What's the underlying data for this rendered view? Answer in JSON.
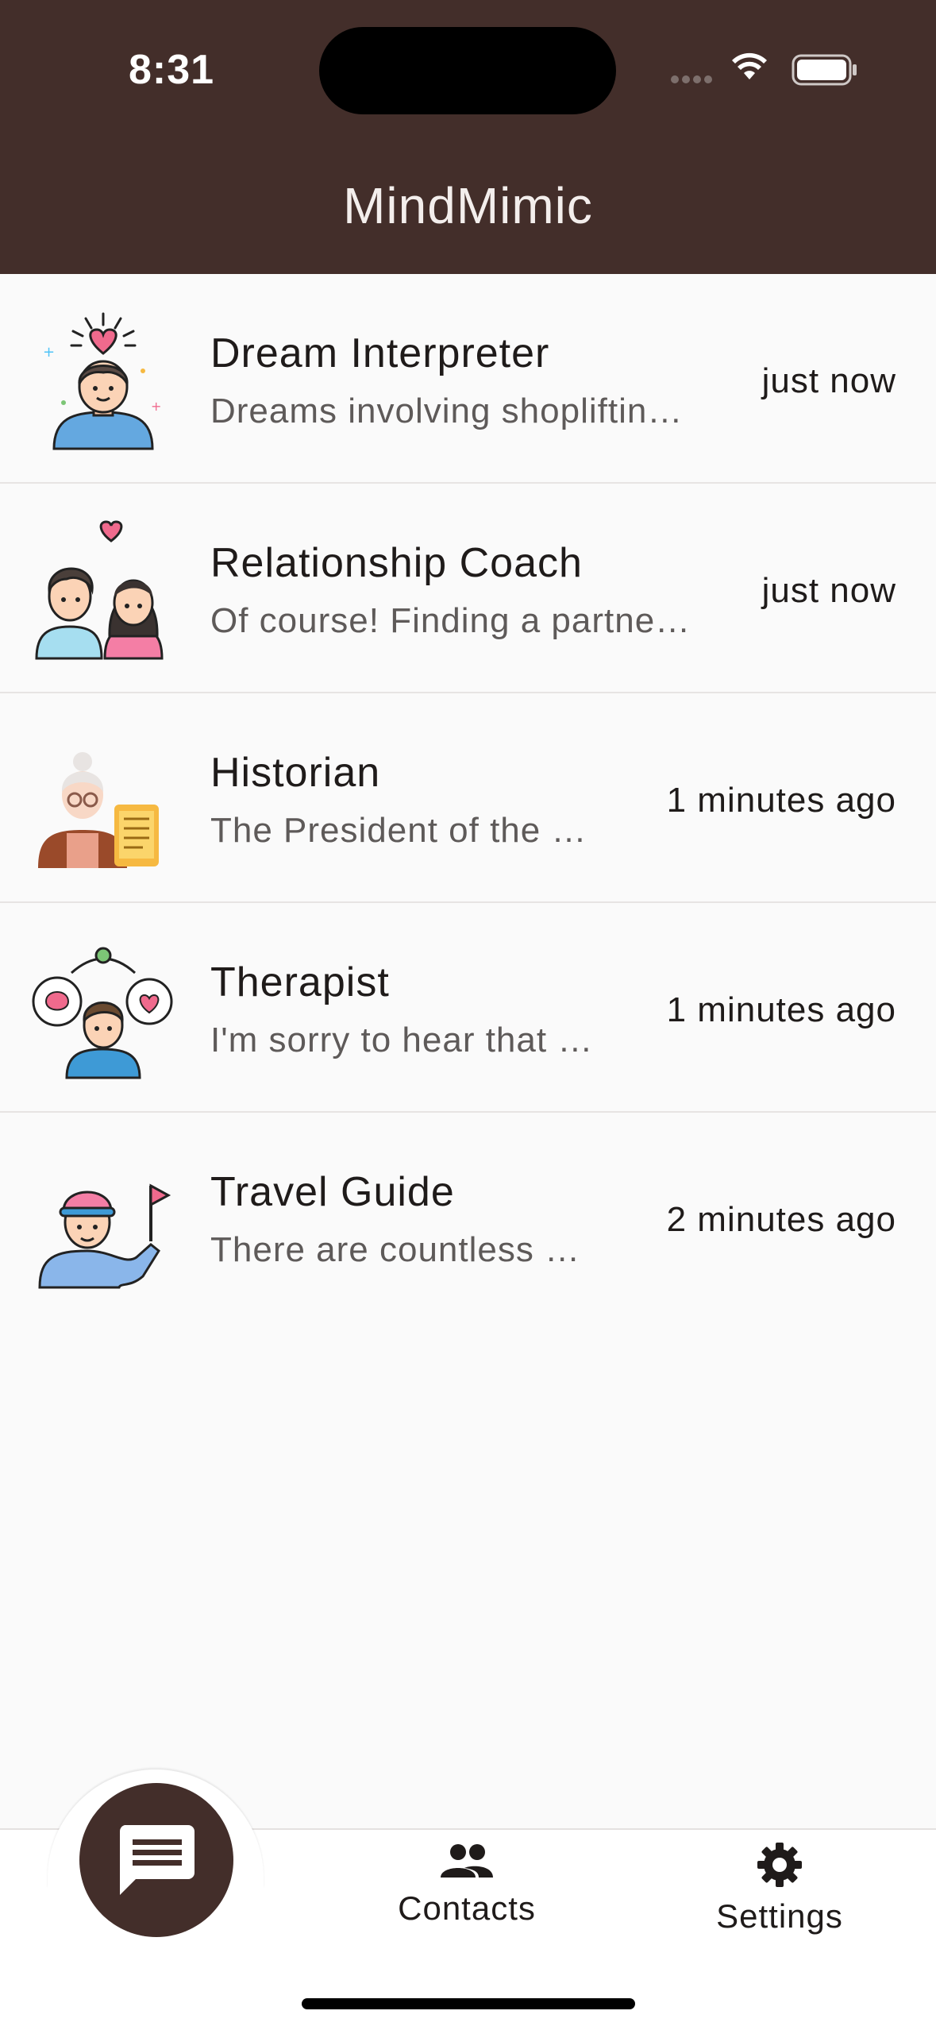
{
  "status_bar": {
    "time": "8:31"
  },
  "header": {
    "title": "MindMimic"
  },
  "chats": [
    {
      "title": "Dream Interpreter",
      "preview": "Dreams involving shopliftin…",
      "time": "just now",
      "avatar_icon": "dream-interpreter-avatar-icon"
    },
    {
      "title": "Relationship Coach",
      "preview": "Of course! Finding a partne…",
      "time": "just now",
      "avatar_icon": "relationship-coach-avatar-icon"
    },
    {
      "title": "Historian",
      "preview": "The President of the …",
      "time": "1 minutes ago",
      "avatar_icon": "historian-avatar-icon"
    },
    {
      "title": "Therapist",
      "preview": "I'm sorry to hear that …",
      "time": "1 minutes ago",
      "avatar_icon": "therapist-avatar-icon"
    },
    {
      "title": "Travel Guide",
      "preview": "There are countless …",
      "time": "2 minutes ago",
      "avatar_icon": "travel-guide-avatar-icon"
    }
  ],
  "bottom_nav": {
    "chats_icon": "chat-icon",
    "contacts_label": "Contacts",
    "contacts_icon": "people-icon",
    "settings_label": "Settings",
    "settings_icon": "gear-icon"
  },
  "colors": {
    "brand": "#432e2a",
    "background": "#fafafa",
    "title_text": "#1f1b1a",
    "preview_text": "#5e5a59"
  }
}
